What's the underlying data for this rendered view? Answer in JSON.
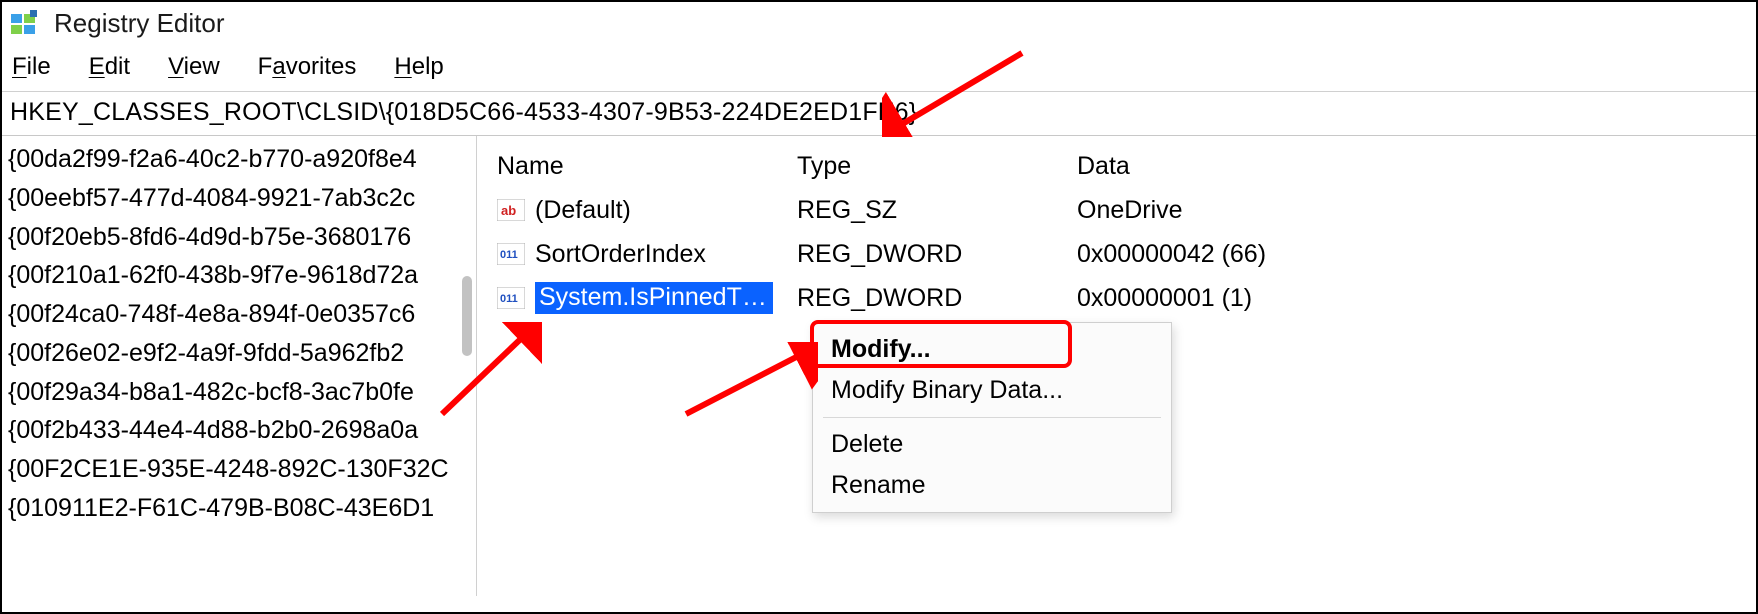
{
  "app": {
    "title": "Registry Editor"
  },
  "menu": {
    "file": "File",
    "edit": "Edit",
    "view": "View",
    "favorites": "Favorites",
    "help": "Help"
  },
  "address": "HKEY_CLASSES_ROOT\\CLSID\\{018D5C66-4533-4307-9B53-224DE2ED1FE6}",
  "tree_keys": [
    "{00da2f99-f2a6-40c2-b770-a920f8e4",
    "{00eebf57-477d-4084-9921-7ab3c2c",
    "{00f20eb5-8fd6-4d9d-b75e-3680176",
    "{00f210a1-62f0-438b-9f7e-9618d72a",
    "{00f24ca0-748f-4e8a-894f-0e0357c6",
    "{00f26e02-e9f2-4a9f-9fdd-5a962fb2",
    "{00f29a34-b8a1-482c-bcf8-3ac7b0fe",
    "{00f2b433-44e4-4d88-b2b0-2698a0a",
    "{00F2CE1E-935E-4248-892C-130F32C",
    "{010911E2-F61C-479B-B08C-43E6D1"
  ],
  "columns": {
    "name": "Name",
    "type": "Type",
    "data": "Data"
  },
  "values": [
    {
      "name": "(Default)",
      "type": "REG_SZ",
      "data": "OneDrive",
      "icon": "sz"
    },
    {
      "name": "SortOrderIndex",
      "type": "REG_DWORD",
      "data": "0x00000042 (66)",
      "icon": "dw"
    },
    {
      "name": "System.IsPinnedT…",
      "type": "REG_DWORD",
      "data": "0x00000001 (1)",
      "icon": "dw",
      "selected": true
    }
  ],
  "context": {
    "modify": "Modify...",
    "modify_binary": "Modify Binary Data...",
    "delete": "Delete",
    "rename": "Rename"
  }
}
